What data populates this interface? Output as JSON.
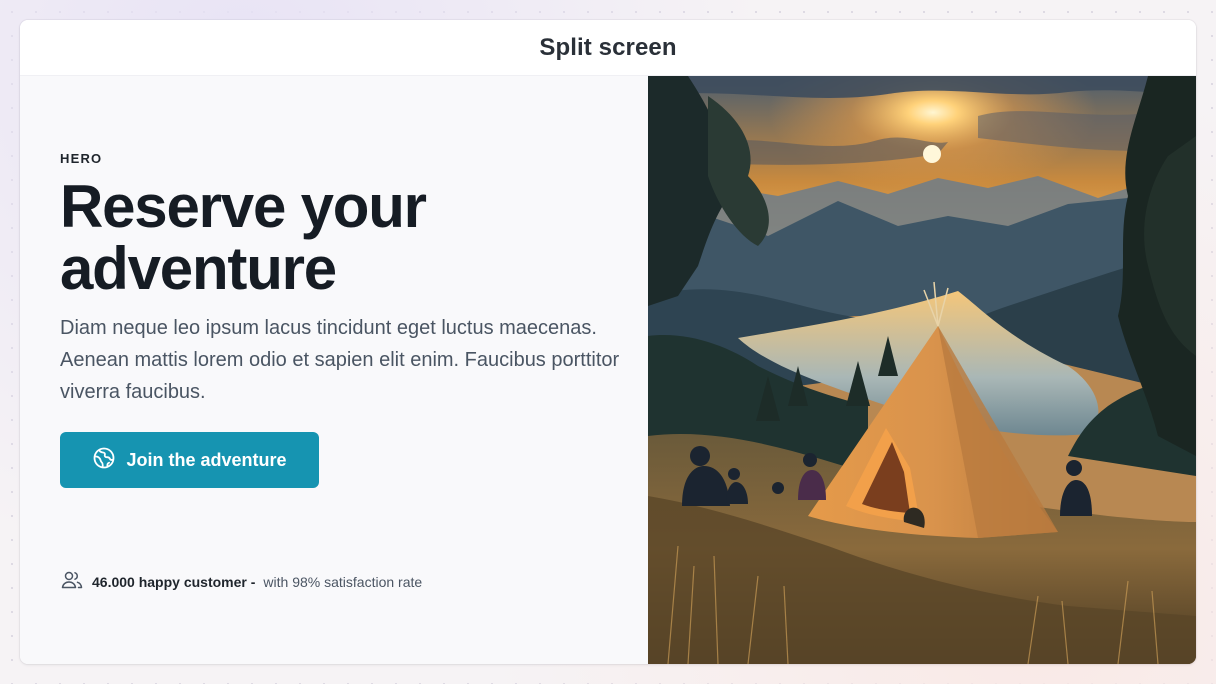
{
  "window": {
    "title": "Split screen"
  },
  "hero": {
    "eyebrow": "HERO",
    "headline": "Reserve your adventure",
    "description": "Diam neque leo ipsum lacus tincidunt eget luctus maecenas. Aenean mattis lorem odio et sapien elit enim. Faucibus porttitor viverra faucibus.",
    "cta": {
      "label": "Join the adventure",
      "icon": "globe-icon",
      "color": "#1694b1"
    },
    "social_proof": {
      "icon": "users-icon",
      "count": "46.000 happy customer -",
      "detail": "with 98% satisfaction rate"
    }
  },
  "image": {
    "alt": "Campers around a tent on a hillside above a lake at sunset"
  },
  "colors": {
    "accent": "#1694b1",
    "heading": "#161c24",
    "body": "#4a5563"
  }
}
